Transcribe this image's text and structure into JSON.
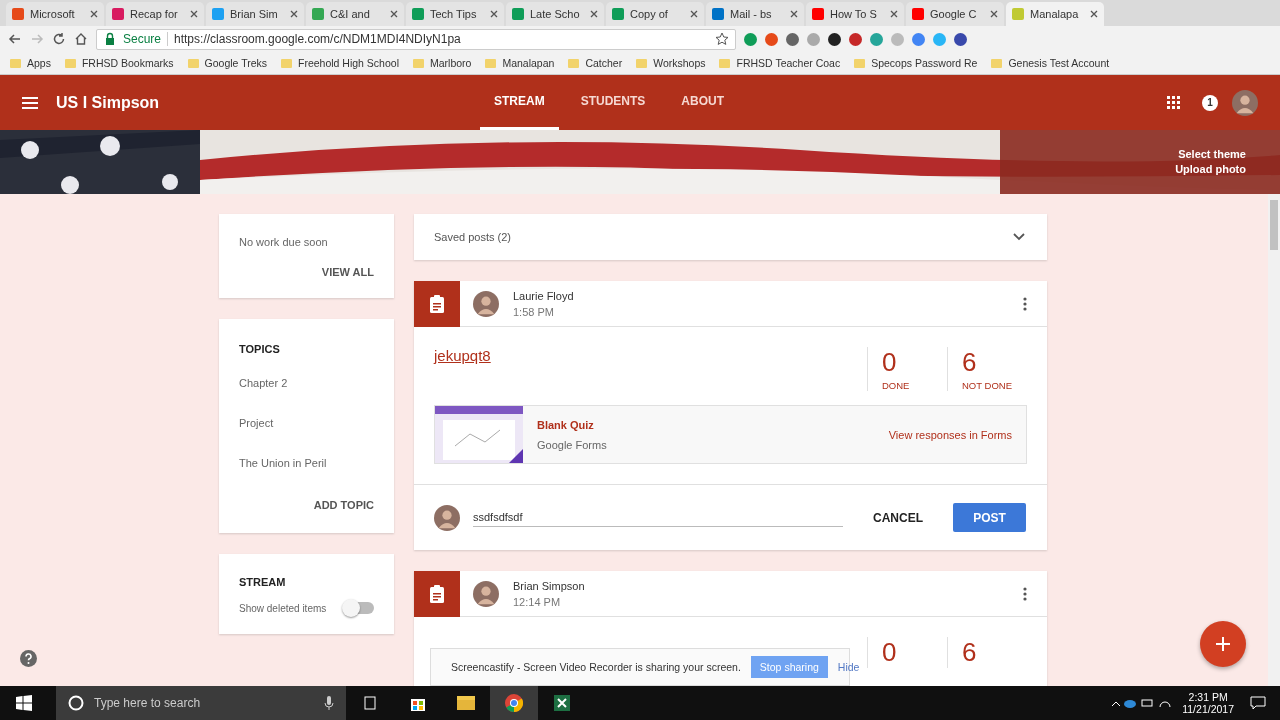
{
  "browser": {
    "tabs": [
      {
        "title": "Microsoft",
        "color": "#e64a19",
        "selected": false
      },
      {
        "title": "Recap for",
        "color": "#d81b60",
        "selected": false
      },
      {
        "title": "Brian Sim",
        "color": "#1da1f2",
        "selected": false
      },
      {
        "title": "C&I and",
        "color": "#34a853",
        "selected": false
      },
      {
        "title": "Tech Tips",
        "color": "#0f9d58",
        "selected": false
      },
      {
        "title": "Late Scho",
        "color": "#0f9d58",
        "selected": false
      },
      {
        "title": "Copy of",
        "color": "#0f9d58",
        "selected": false
      },
      {
        "title": "Mail - bs",
        "color": "#0072c6",
        "selected": false
      },
      {
        "title": "How To S",
        "color": "#ff0000",
        "selected": false
      },
      {
        "title": "Google C",
        "color": "#ff0000",
        "selected": false
      },
      {
        "title": "Manalapa",
        "color": "#c0ca33",
        "selected": true
      }
    ],
    "address": {
      "secure_label": "Secure",
      "url": "https://classroom.google.com/c/NDM1MDI4NDIyN1pa"
    },
    "bookmarks": [
      "Apps",
      "FRHSD Bookmarks",
      "Google Treks",
      "Freehold High School",
      "Marlboro",
      "Manalapan",
      "Catcher",
      "Workshops",
      "FRHSD Teacher Coac",
      "Specops Password Re",
      "Genesis Test Account"
    ]
  },
  "header": {
    "class_name": "US I Simpson",
    "nav": [
      {
        "label": "STREAM",
        "selected": true
      },
      {
        "label": "STUDENTS",
        "selected": false
      },
      {
        "label": "ABOUT",
        "selected": false
      }
    ],
    "notification_count": "1"
  },
  "banner": {
    "links": [
      "Select theme",
      "Upload photo"
    ]
  },
  "upcoming": {
    "text": "No work due soon",
    "action": "VIEW ALL"
  },
  "topics": {
    "title": "TOPICS",
    "items": [
      "Chapter 2",
      "Project",
      "The Union in Peril"
    ],
    "action": "ADD TOPIC"
  },
  "stream_settings": {
    "title": "STREAM",
    "toggle_label": "Show deleted items",
    "on": false
  },
  "saved_posts": {
    "label": "Saved posts (2)",
    "expanded": false
  },
  "posts": [
    {
      "author": "Laurie Floyd",
      "time": "1:58 PM",
      "title": "jekupqt8",
      "done": "0",
      "done_label": "DONE",
      "not_done": "6",
      "not_done_label": "NOT DONE",
      "attachment": {
        "title": "Blank Quiz",
        "subtitle": "Google Forms",
        "action": "View responses in Forms"
      },
      "comment": {
        "value": "ssdfsdfsdf",
        "cancel": "CANCEL",
        "post": "POST"
      }
    },
    {
      "author": "Brian Simpson",
      "time": "12:14 PM",
      "done": "0",
      "not_done": "6"
    }
  ],
  "share_bar": {
    "message": "Screencastify - Screen Video Recorder is sharing your screen.",
    "stop": "Stop sharing",
    "hide": "Hide"
  },
  "taskbar": {
    "search_placeholder": "Type here to search",
    "time": "2:31 PM",
    "date": "11/21/2017"
  }
}
